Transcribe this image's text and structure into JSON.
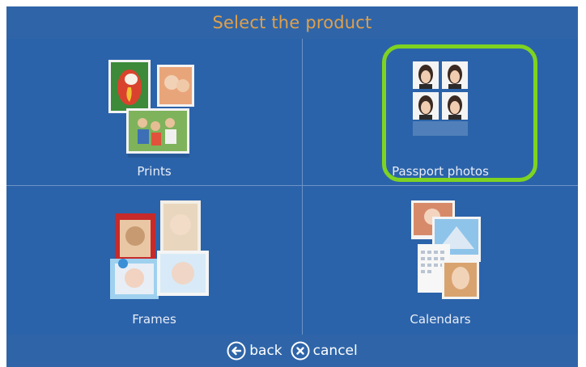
{
  "header": {
    "title": "Select the product"
  },
  "products": [
    {
      "label": "Prints",
      "icon": "prints-collage-icon"
    },
    {
      "label": "Passport photos",
      "icon": "passport-photos-icon"
    },
    {
      "label": "Frames",
      "icon": "frames-collage-icon"
    },
    {
      "label": "Calendars",
      "icon": "calendars-collage-icon"
    }
  ],
  "footer": {
    "back_label": "back",
    "cancel_label": "cancel"
  },
  "colors": {
    "background": "#2f65a8",
    "tile": "#2b63aa",
    "divider": "#6d93c6",
    "title_text": "#e0a04a",
    "highlight": "#7ed321"
  }
}
